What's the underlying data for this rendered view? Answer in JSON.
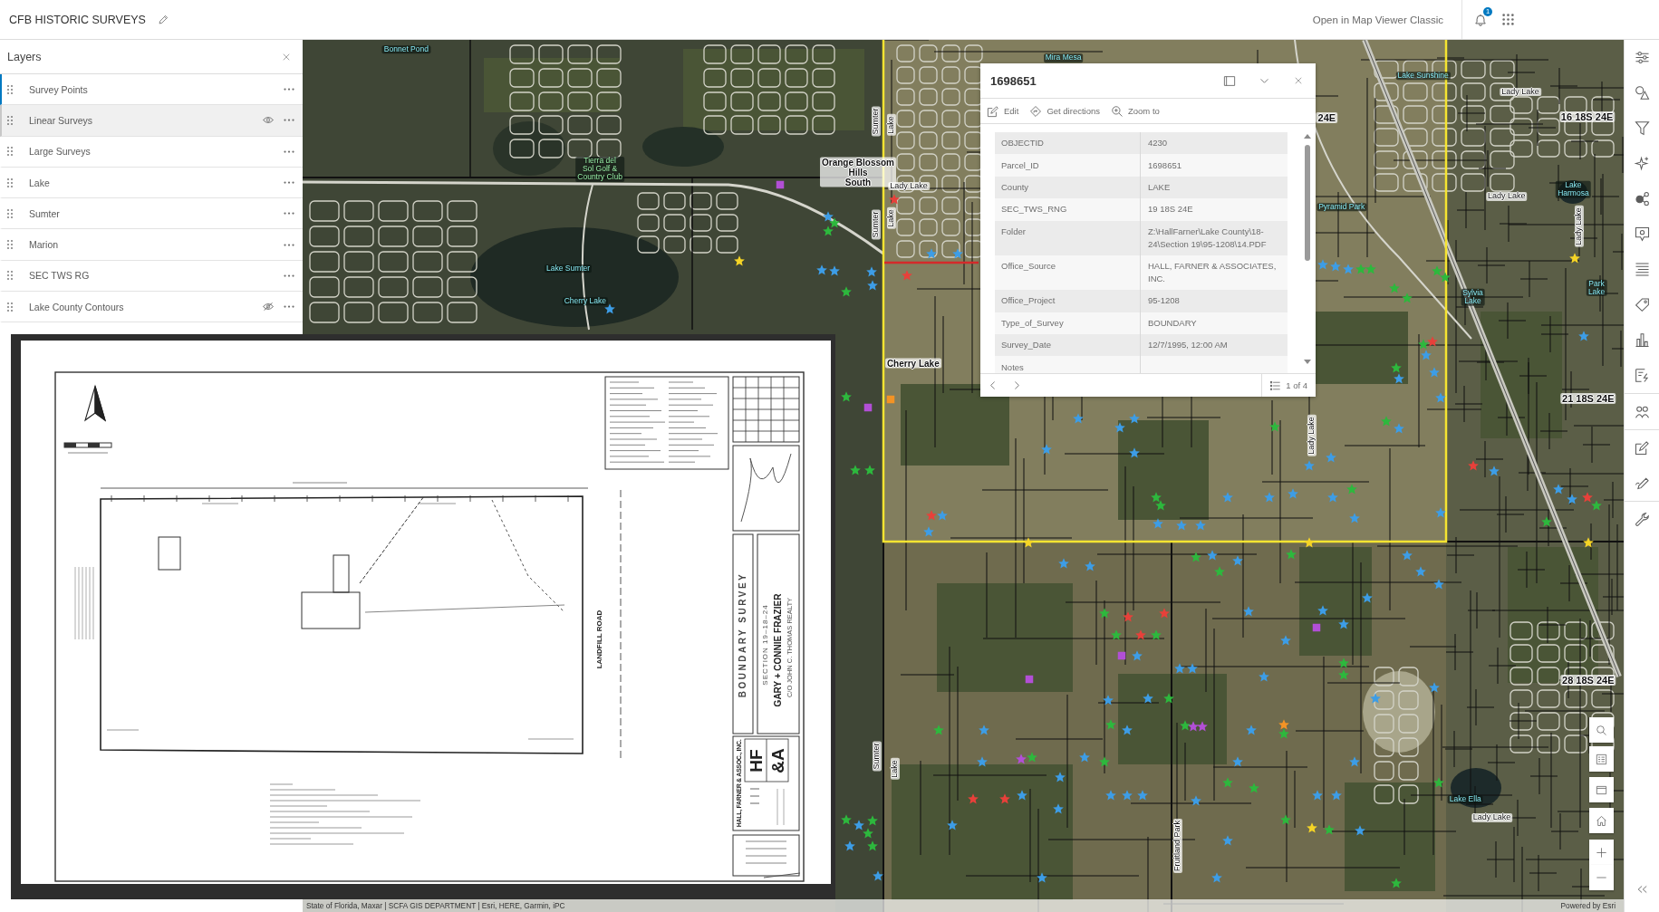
{
  "header": {
    "title": "CFB HISTORIC SURVEYS",
    "classic_link": "Open in Map Viewer Classic",
    "notification_count": "1"
  },
  "layers_panel": {
    "title": "Layers",
    "layers": [
      {
        "label": "Survey Points",
        "selected": true,
        "hovered": false,
        "hidden": false
      },
      {
        "label": "Linear Surveys",
        "selected": false,
        "hovered": true,
        "hidden": false
      },
      {
        "label": "Large Surveys",
        "selected": false,
        "hovered": false,
        "hidden": false
      },
      {
        "label": "Lake",
        "selected": false,
        "hovered": false,
        "hidden": false
      },
      {
        "label": "Sumter",
        "selected": false,
        "hovered": false,
        "hidden": false
      },
      {
        "label": "Marion",
        "selected": false,
        "hovered": false,
        "hidden": false
      },
      {
        "label": "SEC TWS RG",
        "selected": false,
        "hovered": false,
        "hidden": false
      },
      {
        "label": "Lake County Contours",
        "selected": false,
        "hovered": false,
        "hidden": true
      }
    ]
  },
  "document": {
    "road": "LANDFILL ROAD",
    "survey_type": "BOUNDARY SURVEY",
    "section": "SECTION 19–18–24",
    "client": "GARY + CONNIE FRAZIER",
    "care_of": "C/O JOHN C. THOMAS REALTY",
    "firm": "HALL, FARNER & ASSOC., INC.",
    "monogram": [
      "HF",
      "&A"
    ]
  },
  "map": {
    "labels": [
      {
        "text": "Bonnet Pond",
        "kind": "water"
      },
      {
        "text": "Tierra del\nSol Golf &\nCountry Club",
        "kind": "park"
      },
      {
        "text": "Orange Blossom\nHills\nSouth",
        "kind": "community"
      },
      {
        "text": "Mira Mesa",
        "kind": "water"
      },
      {
        "text": "Lake Sumter",
        "kind": "water"
      },
      {
        "text": "Cherry Lake",
        "kind": "water"
      },
      {
        "text": "Lady Lake",
        "kind": "place"
      },
      {
        "text": "Cherry Lake",
        "kind": "community"
      },
      {
        "text": "Sumter",
        "kind": "road"
      },
      {
        "text": "Lake",
        "kind": "road"
      },
      {
        "text": "Sumter",
        "kind": "road"
      },
      {
        "text": "Lake",
        "kind": "road"
      },
      {
        "text": "Lake Sunshine",
        "kind": "water"
      },
      {
        "text": "Lady Lake",
        "kind": "place"
      },
      {
        "text": "24E",
        "kind": "section"
      },
      {
        "text": "16 18S 24E",
        "kind": "section"
      },
      {
        "text": "Pyramid Park",
        "kind": "water"
      },
      {
        "text": "Lady Lake",
        "kind": "place"
      },
      {
        "text": "Lake\nHarmosa",
        "kind": "water"
      },
      {
        "text": "Lady Lake",
        "kind": "road"
      },
      {
        "text": "Sylvia\nLake",
        "kind": "water"
      },
      {
        "text": "Park\nLake",
        "kind": "water"
      },
      {
        "text": "Lady Lake",
        "kind": "road"
      },
      {
        "text": "21 18S 24E",
        "kind": "section"
      },
      {
        "text": "28 18S 24E",
        "kind": "section"
      },
      {
        "text": "Sumter",
        "kind": "road"
      },
      {
        "text": "Lake",
        "kind": "road"
      },
      {
        "text": "Fruitland Park",
        "kind": "road"
      },
      {
        "text": "Lake Ella",
        "kind": "water"
      },
      {
        "text": "Lady Lake",
        "kind": "place"
      }
    ],
    "markers": [
      {
        "kind": "square",
        "color": "#b24fd6"
      },
      {
        "kind": "star",
        "color": "#3d9de6"
      },
      {
        "kind": "star",
        "color": "#2db83d"
      },
      {
        "kind": "star",
        "color": "#2db83d"
      },
      {
        "kind": "star",
        "color": "#f5d426"
      },
      {
        "kind": "star",
        "color": "#3d9de6"
      },
      {
        "kind": "star",
        "color": "#3d9de6"
      },
      {
        "kind": "star",
        "color": "#3d9de6"
      },
      {
        "kind": "star",
        "color": "#3d9de6"
      },
      {
        "kind": "star",
        "color": "#2db83d"
      },
      {
        "kind": "star",
        "color": "#3d9de6"
      },
      {
        "kind": "star",
        "color": "#e8403a"
      },
      {
        "kind": "star",
        "color": "#e8403a"
      },
      {
        "kind": "star",
        "color": "#3d9de6"
      },
      {
        "kind": "star",
        "color": "#3d9de6"
      },
      {
        "kind": "star",
        "color": "#3d9de6"
      },
      {
        "kind": "star",
        "color": "#3d9de6"
      },
      {
        "kind": "star",
        "color": "#3d9de6"
      },
      {
        "kind": "star",
        "color": "#2db83d"
      },
      {
        "kind": "star",
        "color": "#2db83d"
      },
      {
        "kind": "star",
        "color": "#2db83d"
      },
      {
        "kind": "star",
        "color": "#2db83d"
      },
      {
        "kind": "star",
        "color": "#2db83d"
      },
      {
        "kind": "star",
        "color": "#2db83d"
      },
      {
        "kind": "star",
        "color": "#e8403a"
      },
      {
        "kind": "star",
        "color": "#2db83d"
      },
      {
        "kind": "star",
        "color": "#3d9de6"
      },
      {
        "kind": "star",
        "color": "#2db83d"
      },
      {
        "kind": "star",
        "color": "#3d9de6"
      },
      {
        "kind": "star",
        "color": "#3d9de6"
      },
      {
        "kind": "star",
        "color": "#3d9de6"
      },
      {
        "kind": "star",
        "color": "#f5d426"
      },
      {
        "kind": "star",
        "color": "#3d9de6"
      },
      {
        "kind": "star",
        "color": "#2db83d"
      },
      {
        "kind": "star",
        "color": "#3d9de6"
      },
      {
        "kind": "star",
        "color": "#2db83d"
      },
      {
        "kind": "star",
        "color": "#3d9de6"
      },
      {
        "kind": "star",
        "color": "#3d9de6"
      },
      {
        "kind": "star",
        "color": "#3d9de6"
      },
      {
        "kind": "star",
        "color": "#3d9de6"
      },
      {
        "kind": "star",
        "color": "#3d9de6"
      },
      {
        "kind": "star",
        "color": "#3d9de6"
      },
      {
        "kind": "star",
        "color": "#3d9de6"
      },
      {
        "kind": "star",
        "color": "#2db83d"
      },
      {
        "kind": "square",
        "color": "#b24fd6"
      },
      {
        "kind": "square",
        "color": "#f39325"
      },
      {
        "kind": "star",
        "color": "#2db83d"
      },
      {
        "kind": "star",
        "color": "#2db83d"
      },
      {
        "kind": "star",
        "color": "#e8403a"
      },
      {
        "kind": "star",
        "color": "#3d9de6"
      },
      {
        "kind": "star",
        "color": "#3d9de6"
      },
      {
        "kind": "star",
        "color": "#2db83d"
      },
      {
        "kind": "star",
        "color": "#2db83d"
      },
      {
        "kind": "star",
        "color": "#3d9de6"
      },
      {
        "kind": "star",
        "color": "#3d9de6"
      },
      {
        "kind": "star",
        "color": "#3d9de6"
      },
      {
        "kind": "star",
        "color": "#3d9de6"
      },
      {
        "kind": "star",
        "color": "#3d9de6"
      },
      {
        "kind": "star",
        "color": "#3d9de6"
      },
      {
        "kind": "star",
        "color": "#3d9de6"
      },
      {
        "kind": "star",
        "color": "#2db83d"
      },
      {
        "kind": "star",
        "color": "#3d9de6"
      },
      {
        "kind": "star",
        "color": "#e8403a"
      },
      {
        "kind": "star",
        "color": "#3d9de6"
      },
      {
        "kind": "star",
        "color": "#3d9de6"
      },
      {
        "kind": "star",
        "color": "#3d9de6"
      },
      {
        "kind": "star",
        "color": "#e8403a"
      },
      {
        "kind": "star",
        "color": "#2db83d"
      },
      {
        "kind": "star",
        "color": "#2db83d"
      },
      {
        "kind": "star",
        "color": "#3d9de6"
      },
      {
        "kind": "star",
        "color": "#f5d426"
      },
      {
        "kind": "star",
        "color": "#f5d426"
      },
      {
        "kind": "star",
        "color": "#f5d426"
      },
      {
        "kind": "star",
        "color": "#2db83d"
      },
      {
        "kind": "star",
        "color": "#3d9de6"
      },
      {
        "kind": "star",
        "color": "#2db83d"
      },
      {
        "kind": "star",
        "color": "#3d9de6"
      },
      {
        "kind": "star",
        "color": "#3d9de6"
      },
      {
        "kind": "star",
        "color": "#3d9de6"
      },
      {
        "kind": "star",
        "color": "#2db83d"
      },
      {
        "kind": "star",
        "color": "#3d9de6"
      },
      {
        "kind": "star",
        "color": "#3d9de6"
      },
      {
        "kind": "star",
        "color": "#3d9de6"
      },
      {
        "kind": "star",
        "color": "#3d9de6"
      },
      {
        "kind": "star",
        "color": "#3d9de6"
      },
      {
        "kind": "star",
        "color": "#2db83d"
      },
      {
        "kind": "star",
        "color": "#e8403a"
      },
      {
        "kind": "star",
        "color": "#e8403a"
      },
      {
        "kind": "star",
        "color": "#2db83d"
      },
      {
        "kind": "star",
        "color": "#e8403a"
      },
      {
        "kind": "star",
        "color": "#2db83d"
      },
      {
        "kind": "square",
        "color": "#b24fd6"
      },
      {
        "kind": "star",
        "color": "#3d9de6"
      },
      {
        "kind": "star",
        "color": "#3d9de6"
      },
      {
        "kind": "star",
        "color": "#3d9de6"
      },
      {
        "kind": "square",
        "color": "#b24fd6"
      },
      {
        "kind": "star",
        "color": "#3d9de6"
      },
      {
        "kind": "star",
        "color": "#2db83d"
      },
      {
        "kind": "star",
        "color": "#2db83d"
      },
      {
        "kind": "square",
        "color": "#b24fd6"
      },
      {
        "kind": "star",
        "color": "#3d9de6"
      },
      {
        "kind": "star",
        "color": "#3d9de6"
      },
      {
        "kind": "star",
        "color": "#3d9de6"
      },
      {
        "kind": "star",
        "color": "#3d9de6"
      },
      {
        "kind": "star",
        "color": "#3d9de6"
      },
      {
        "kind": "star",
        "color": "#2db83d"
      },
      {
        "kind": "star",
        "color": "#3d9de6"
      },
      {
        "kind": "star",
        "color": "#3d9de6"
      },
      {
        "kind": "star",
        "color": "#2db83d"
      },
      {
        "kind": "star",
        "color": "#3d9de6"
      },
      {
        "kind": "star",
        "color": "#2db83d"
      },
      {
        "kind": "star",
        "color": "#3d9de6"
      },
      {
        "kind": "star",
        "color": "#2db83d"
      },
      {
        "kind": "star",
        "color": "#b24fd6"
      },
      {
        "kind": "star",
        "color": "#b24fd6"
      },
      {
        "kind": "star",
        "color": "#3d9de6"
      },
      {
        "kind": "star",
        "color": "#f39325"
      },
      {
        "kind": "star",
        "color": "#2db83d"
      },
      {
        "kind": "star",
        "color": "#b24fd6"
      },
      {
        "kind": "star",
        "color": "#2db83d"
      },
      {
        "kind": "star",
        "color": "#3d9de6"
      },
      {
        "kind": "star",
        "color": "#3d9de6"
      },
      {
        "kind": "star",
        "color": "#2db83d"
      },
      {
        "kind": "star",
        "color": "#3d9de6"
      },
      {
        "kind": "star",
        "color": "#3d9de6"
      },
      {
        "kind": "star",
        "color": "#2db83d"
      },
      {
        "kind": "star",
        "color": "#2db83d"
      },
      {
        "kind": "star",
        "color": "#3d9de6"
      },
      {
        "kind": "star",
        "color": "#2db83d"
      },
      {
        "kind": "star",
        "color": "#e8403a"
      },
      {
        "kind": "star",
        "color": "#e8403a"
      },
      {
        "kind": "star",
        "color": "#3d9de6"
      },
      {
        "kind": "star",
        "color": "#3d9de6"
      },
      {
        "kind": "star",
        "color": "#3d9de6"
      },
      {
        "kind": "star",
        "color": "#3d9de6"
      },
      {
        "kind": "star",
        "color": "#3d9de6"
      },
      {
        "kind": "star",
        "color": "#3d9de6"
      },
      {
        "kind": "star",
        "color": "#3d9de6"
      },
      {
        "kind": "star",
        "color": "#2db83d"
      },
      {
        "kind": "star",
        "color": "#2db83d"
      },
      {
        "kind": "star",
        "color": "#3d9de6"
      },
      {
        "kind": "star",
        "color": "#2db83d"
      },
      {
        "kind": "star",
        "color": "#2db83d"
      },
      {
        "kind": "star",
        "color": "#3d9de6"
      },
      {
        "kind": "star",
        "color": "#2db83d"
      },
      {
        "kind": "star",
        "color": "#3d9de6"
      },
      {
        "kind": "star",
        "color": "#3d9de6"
      },
      {
        "kind": "star",
        "color": "#f5d426"
      },
      {
        "kind": "star",
        "color": "#2db83d"
      },
      {
        "kind": "star",
        "color": "#3d9de6"
      },
      {
        "kind": "star",
        "color": "#3d9de6"
      },
      {
        "kind": "star",
        "color": "#3d9de6"
      },
      {
        "kind": "star",
        "color": "#3d9de6"
      },
      {
        "kind": "star",
        "color": "#3d9de6"
      },
      {
        "kind": "star",
        "color": "#2db83d"
      }
    ]
  },
  "popup": {
    "title": "1698651",
    "actions": [
      {
        "label": "Edit",
        "kind": "edit"
      },
      {
        "label": "Get directions",
        "kind": "directions"
      },
      {
        "label": "Zoom to",
        "kind": "zoom"
      }
    ],
    "fields": [
      {
        "name": "OBJECTID",
        "value": "4230"
      },
      {
        "name": "Parcel_ID",
        "value": "1698651"
      },
      {
        "name": "County",
        "value": "LAKE"
      },
      {
        "name": "SEC_TWS_RNG",
        "value": "19 18S 24E"
      },
      {
        "name": "Folder",
        "value": "Z:\\HallFarner\\Lake County\\18-24\\Section 19\\95-1208\\14.PDF"
      },
      {
        "name": "Office_Source",
        "value": "HALL, FARNER & ASSOCIATES, INC."
      },
      {
        "name": "Office_Project",
        "value": "95-1208"
      },
      {
        "name": "Type_of_Survey",
        "value": "BOUNDARY"
      },
      {
        "name": "Survey_Date",
        "value": "12/7/1995, 12:00 AM"
      },
      {
        "name": "Notes"
      }
    ],
    "pager": "1 of 4"
  },
  "attribution": {
    "sources": "State of Florida, Maxar | SCFA GIS DEPARTMENT | Esri, HERE, Garmin, iPC",
    "powered_by": "Powered by Esri"
  }
}
